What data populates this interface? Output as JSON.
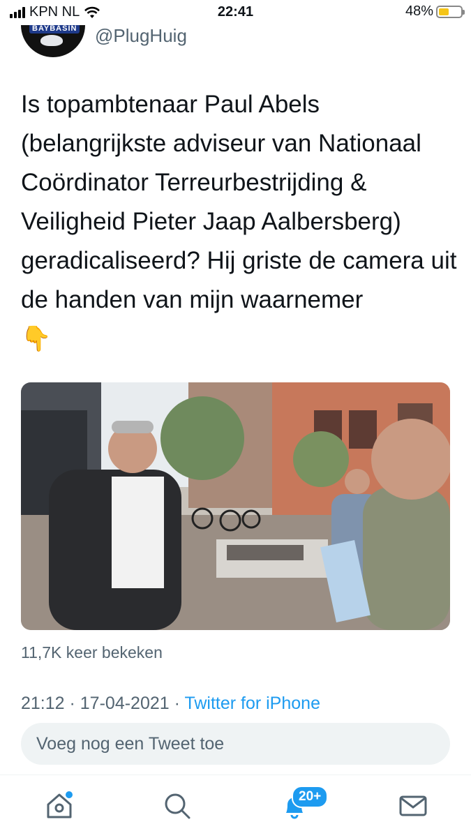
{
  "status_bar": {
    "carrier": "KPN NL",
    "time": "22:41",
    "battery_percent": "48%",
    "battery_level": 0.48
  },
  "tweet": {
    "avatar_label": "BAYBASIN",
    "handle": "@PlugHuig",
    "text": "Is topambtenaar Paul Abels (belangrijkste adviseur van Nationaal Coördinator Terreurbestrijding & Veiligheid Pieter Jaap Aalbersberg) geradicaliseerd? Hij griste de camera uit de handen van mijn waarnemer",
    "emoji": "👇",
    "views": "11,7K keer bekeken",
    "timestamp": "21:12 · 17-04-2021 · ",
    "source": "Twitter for iPhone"
  },
  "reply": {
    "placeholder": "Voeg nog een Tweet toe"
  },
  "tab_bar": {
    "notifications_badge": "20+",
    "icons": [
      "home-icon",
      "search-icon",
      "notifications-icon",
      "messages-icon"
    ]
  },
  "colors": {
    "accent": "#1d9bf0",
    "secondary_text": "#536471",
    "text": "#0f1419"
  }
}
